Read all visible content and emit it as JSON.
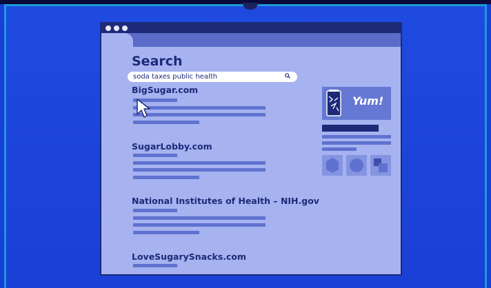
{
  "page": {
    "title": "Search",
    "search": {
      "query": "soda taxes public health"
    },
    "results": [
      {
        "title": "BigSugar.com"
      },
      {
        "title": "SugarLobby.com"
      },
      {
        "title": "National Institutes of Health – NIH.gov"
      },
      {
        "title": "LoveSugarySnacks.com"
      }
    ],
    "ad": {
      "text": "Yum!"
    }
  },
  "icons": [
    "search-icon",
    "cursor-icon",
    "soda-can-icon",
    "hexagon-icon",
    "circle-icon",
    "squares-icon"
  ],
  "colors": {
    "background": "#1a3fd6",
    "frame_border": "#1b9ad8",
    "page": "#a6b3f0",
    "dark_navy": "#1c2a78",
    "placeholder_line": "#5f72cf"
  }
}
